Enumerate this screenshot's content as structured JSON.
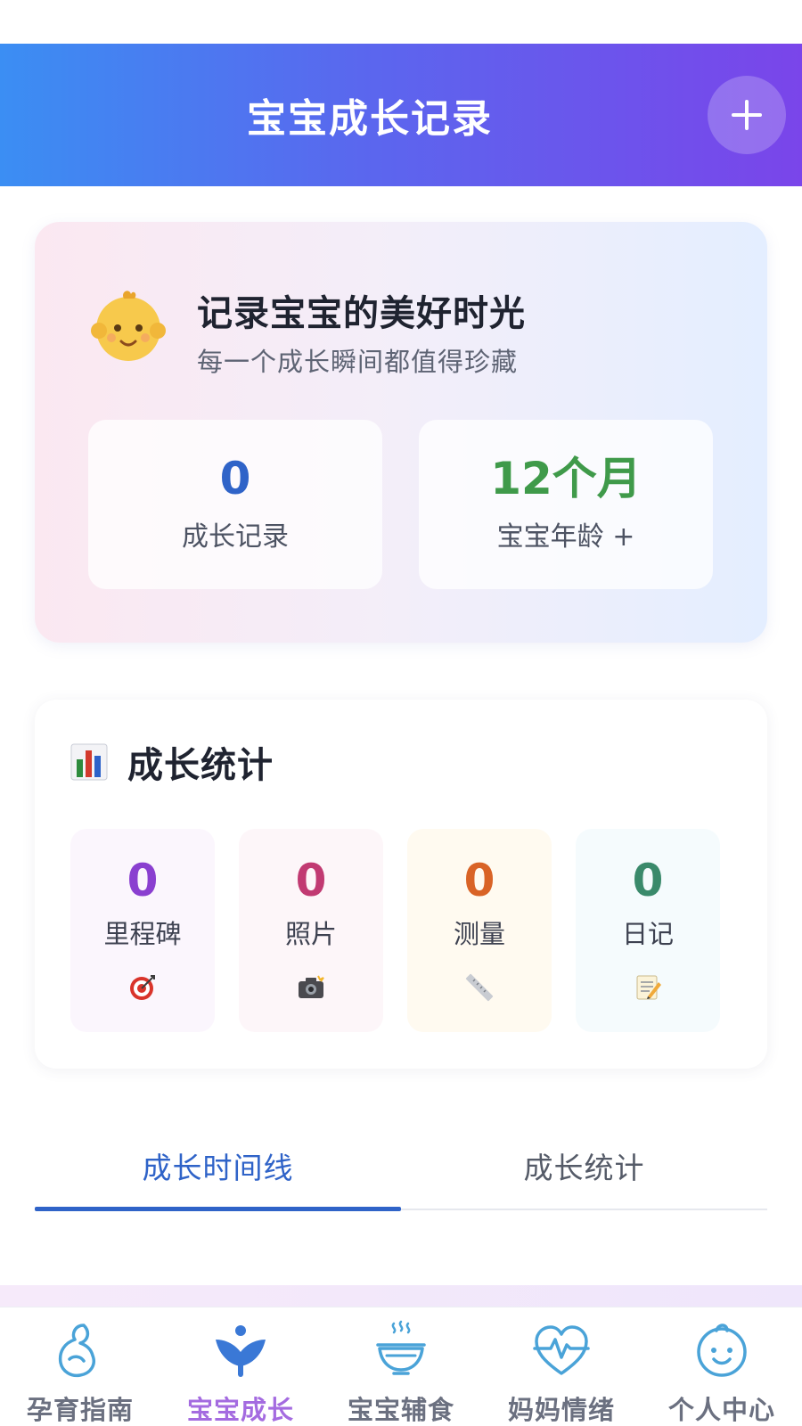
{
  "header": {
    "title": "宝宝成长记录",
    "add_icon": "plus-icon"
  },
  "hero": {
    "icon": "baby-face-icon",
    "title": "记录宝宝的美好时光",
    "subtitle": "每一个成长瞬间都值得珍藏",
    "stats": [
      {
        "value": "0",
        "label": "成长记录",
        "color": "#2f63c8"
      },
      {
        "value": "12个月",
        "label": "宝宝年龄 +",
        "color": "#3f9a4a"
      }
    ]
  },
  "growth_stats": {
    "icon": "bar-chart-icon",
    "title": "成长统计",
    "items": [
      {
        "value": "0",
        "label": "里程碑",
        "icon": "target-icon",
        "color": "#8a3fd0",
        "bg": "#fbf6fd"
      },
      {
        "value": "0",
        "label": "照片",
        "icon": "camera-icon",
        "color": "#c13a72",
        "bg": "#fdf6f9"
      },
      {
        "value": "0",
        "label": "测量",
        "icon": "ruler-icon",
        "color": "#d96326",
        "bg": "#fffaf0"
      },
      {
        "value": "0",
        "label": "日记",
        "icon": "memo-icon",
        "color": "#3a8a6b",
        "bg": "#f5fbfd"
      }
    ]
  },
  "tabs": [
    {
      "label": "成长时间线",
      "active": true
    },
    {
      "label": "成长统计",
      "active": false
    }
  ],
  "bottom_nav": [
    {
      "label": "孕育指南",
      "icon": "pregnancy-icon",
      "active": false
    },
    {
      "label": "宝宝成长",
      "icon": "sprout-icon",
      "active": true
    },
    {
      "label": "宝宝辅食",
      "icon": "food-bowl-icon",
      "active": false
    },
    {
      "label": "妈妈情绪",
      "icon": "heartbeat-icon",
      "active": false
    },
    {
      "label": "个人中心",
      "icon": "child-face-icon",
      "active": false
    }
  ],
  "colors": {
    "accent": "#2f63c8",
    "nav_active": "#a46be0",
    "header_start": "#3b8ef3",
    "header_end": "#7a45ea"
  }
}
